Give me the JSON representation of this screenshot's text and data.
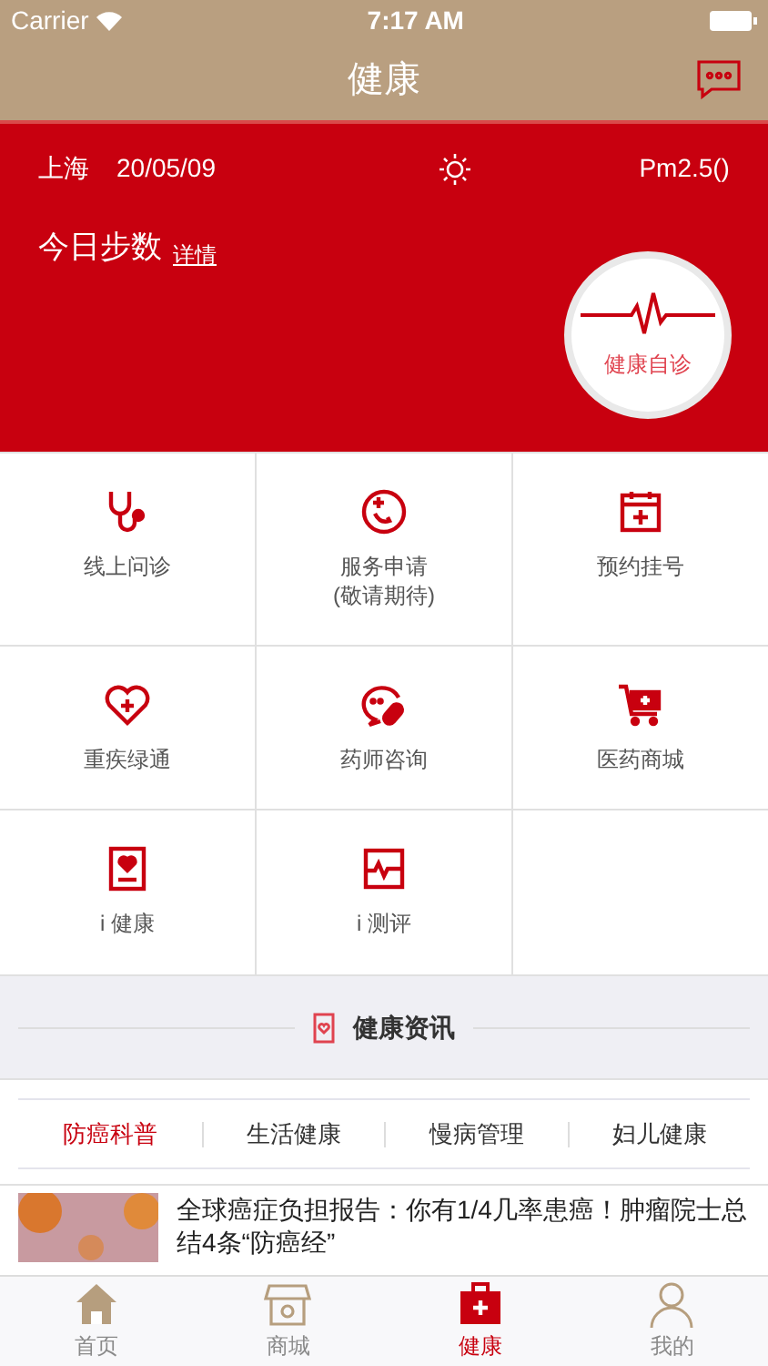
{
  "status_bar": {
    "carrier": "Carrier",
    "time": "7:17 AM"
  },
  "nav": {
    "title": "健康"
  },
  "banner": {
    "city": "上海",
    "date": "20/05/09",
    "pm": "Pm2.5()",
    "steps_label": "今日步数",
    "details_link": "详情",
    "self_check": "健康自诊"
  },
  "services": [
    {
      "label": "线上问诊"
    },
    {
      "label": "服务申请\n(敬请期待)"
    },
    {
      "label": "预约挂号"
    },
    {
      "label": "重疾绿通"
    },
    {
      "label": "药师咨询"
    },
    {
      "label": "医药商城"
    },
    {
      "label": "i 健康"
    },
    {
      "label": "i 测评"
    }
  ],
  "news_header": "健康资讯",
  "news_tabs": [
    {
      "label": "防癌科普",
      "selected": true
    },
    {
      "label": "生活健康",
      "selected": false
    },
    {
      "label": "慢病管理",
      "selected": false
    },
    {
      "label": "妇儿健康",
      "selected": false
    }
  ],
  "articles": [
    {
      "kind": "picture",
      "title": "全球癌症负担报告：你有1/4几率患癌！肿瘤院士总结4条“防癌经”"
    }
  ],
  "tab_bar": [
    {
      "label": "首页",
      "selected": false
    },
    {
      "label": "商城",
      "selected": false
    },
    {
      "label": "健康",
      "selected": true
    },
    {
      "label": "我的",
      "selected": false
    }
  ]
}
